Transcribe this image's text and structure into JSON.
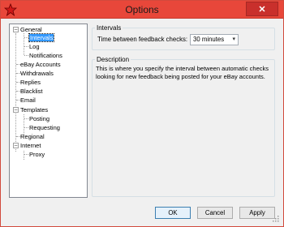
{
  "window": {
    "title": "Options",
    "close_glyph": "✕"
  },
  "icons": {
    "app": "star-icon",
    "close": "close-icon",
    "expand": "minus-icon",
    "dropdown": "chevron-down-icon"
  },
  "tree": {
    "items": [
      {
        "label": "General",
        "expanded": true
      },
      {
        "label": "Intervals",
        "selected": true
      },
      {
        "label": "Log"
      },
      {
        "label": "Notifications"
      },
      {
        "label": "eBay Accounts"
      },
      {
        "label": "Withdrawals"
      },
      {
        "label": "Replies"
      },
      {
        "label": "Blacklist"
      },
      {
        "label": "Email"
      },
      {
        "label": "Templates",
        "expanded": true
      },
      {
        "label": "Posting"
      },
      {
        "label": "Requesting"
      },
      {
        "label": "Regional"
      },
      {
        "label": "Internet",
        "expanded": true
      },
      {
        "label": "Proxy"
      }
    ],
    "expander_glyph": "−"
  },
  "intervals": {
    "title": "Intervals",
    "label": "Time between feedback checks:",
    "value": "30 minutes",
    "arrow": "▾"
  },
  "description": {
    "title": "Description",
    "text": "This is where you specify the interval between automatic checks looking for new feedback being posted for your eBay accounts."
  },
  "buttons": {
    "ok": "OK",
    "cancel": "Cancel",
    "apply": "Apply"
  },
  "colors": {
    "titlebar": "#e8473a",
    "close": "#c9302c",
    "selection": "#3399ff"
  }
}
